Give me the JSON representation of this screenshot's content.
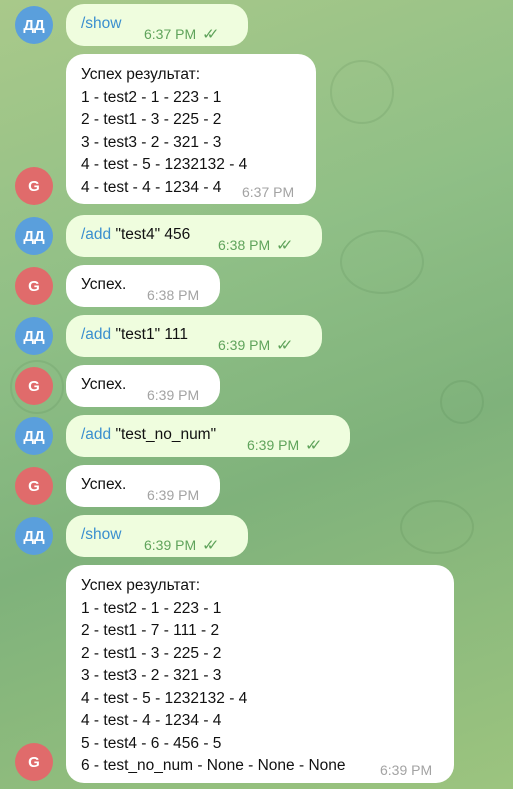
{
  "messages": [
    {
      "sender": "ДД",
      "side": "out",
      "command": "/show",
      "args": "",
      "time": "6:37 PM"
    },
    {
      "sender": "G",
      "side": "in",
      "lines": [
        "Успех результат:",
        "1 - test2 - 1 - 223 - 1",
        "2 - test1 - 3 - 225 - 2",
        "3 - test3 - 2 - 321 - 3",
        "4 - test - 5 - 1232132 - 4",
        "4 - test - 4 - 1234 - 4"
      ],
      "time": "6:37 PM"
    },
    {
      "sender": "ДД",
      "side": "out",
      "command": "/add",
      "args": " \"test4\" 456",
      "time": "6:38 PM"
    },
    {
      "sender": "G",
      "side": "in",
      "lines": [
        "Успех."
      ],
      "time": "6:38 PM"
    },
    {
      "sender": "ДД",
      "side": "out",
      "command": "/add",
      "args": " \"test1\" 111",
      "time": "6:39 PM"
    },
    {
      "sender": "G",
      "side": "in",
      "lines": [
        "Успех."
      ],
      "time": "6:39 PM"
    },
    {
      "sender": "ДД",
      "side": "out",
      "command": "/add",
      "args": " \"test_no_num\"",
      "time": "6:39 PM"
    },
    {
      "sender": "G",
      "side": "in",
      "lines": [
        "Успех."
      ],
      "time": "6:39 PM"
    },
    {
      "sender": "ДД",
      "side": "out",
      "command": "/show",
      "args": "",
      "time": "6:39 PM"
    },
    {
      "sender": "G",
      "side": "in",
      "lines": [
        "Успех результат:",
        "1 - test2 - 1 - 223 - 1",
        "2 - test1 - 7 - 111 - 2",
        "2 - test1 - 3 - 225 - 2",
        "3 - test3 - 2 - 321 - 3",
        "4 - test - 5 - 1232132 - 4",
        "4 - test - 4 - 1234 - 4",
        "5 - test4 - 6 - 456 - 5",
        "6 - test_no_num - None - None - None"
      ],
      "time": "6:39 PM"
    }
  ],
  "read_icon": "double-check-icon",
  "colors": {
    "out_bubble": "#effdde",
    "in_bubble": "#ffffff",
    "link": "#3a8fcf",
    "avatar_dd": "#5a9fdc",
    "avatar_g": "#e06b6b"
  }
}
